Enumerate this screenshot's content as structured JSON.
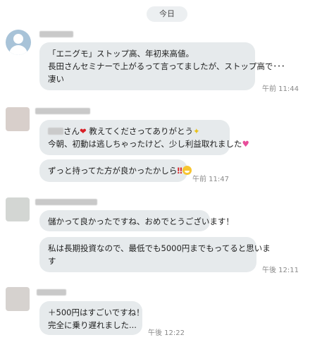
{
  "date_divider": "今日",
  "messages": [
    {
      "lines": [
        "「エニグモ」ストップ高、年初来高値。",
        "長田さんセミナーで上がるって言ってましたが、ストップ高で･･･",
        "凄い"
      ],
      "time": "午前 11:44"
    },
    {
      "line1_suffix": "さん",
      "line1_rest": " 教えてくださってありがとう",
      "line2": "今朝、初動は逃しちゃったけど、少し利益取れました",
      "reply": "ずっと持ってた方が良かったかしら",
      "time": "午前 11:47"
    },
    {
      "text1": "儲かって良かったですね、おめでとうございます！",
      "text2_lines": [
        "私は長期投資なので、最低でも5000円までもってると思いま",
        "す"
      ],
      "time": "午後 12:11"
    },
    {
      "lines": [
        "＋500円はすごいですね！",
        "完全に乗り遅れました..."
      ],
      "time": "午後 12:22"
    }
  ],
  "icons": {
    "heart": "red-heart-icon",
    "sparkle": "sparkle-icon",
    "heart_pink": "sparkling-heart-icon",
    "exclamation": "double-exclamation-icon",
    "grin": "grinning-face-icon"
  },
  "colors": {
    "bubble": "#e6eaec",
    "background": "#ffffff",
    "timestamp": "#8a8a8a"
  }
}
